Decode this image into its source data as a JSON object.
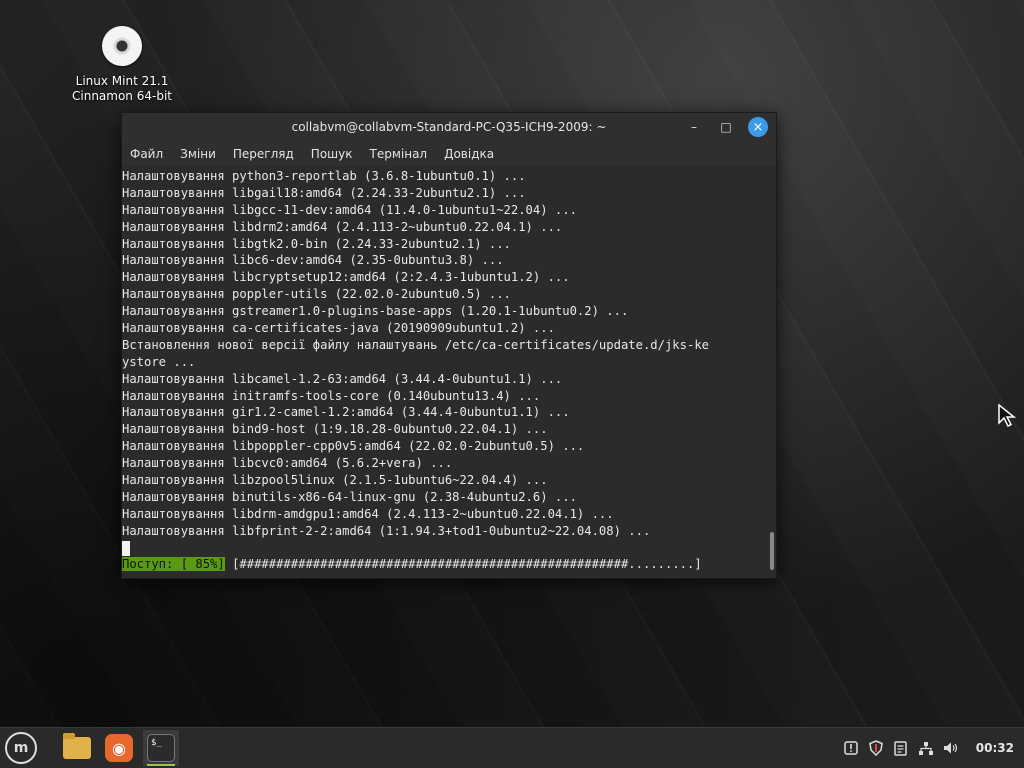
{
  "desktop": {
    "icon_label_line1": "Linux Mint 21.1",
    "icon_label_line2": "Cinnamon 64-bit"
  },
  "window": {
    "title": "collabvm@collabvm-Standard-PC-Q35-ICH9-2009: ~",
    "minimize_glyph": "–",
    "maximize_glyph": "□",
    "close_glyph": "×"
  },
  "menu": [
    "Файл",
    "Зміни",
    "Перегляд",
    "Пошук",
    "Термінал",
    "Довідка"
  ],
  "terminal_lines": [
    "Налаштовування python3-reportlab (3.6.8-1ubuntu0.1) ...",
    "Налаштовування libgail18:amd64 (2.24.33-2ubuntu2.1) ...",
    "Налаштовування libgcc-11-dev:amd64 (11.4.0-1ubuntu1~22.04) ...",
    "Налаштовування libdrm2:amd64 (2.4.113-2~ubuntu0.22.04.1) ...",
    "Налаштовування libgtk2.0-bin (2.24.33-2ubuntu2.1) ...",
    "Налаштовування libc6-dev:amd64 (2.35-0ubuntu3.8) ...",
    "Налаштовування libcryptsetup12:amd64 (2:2.4.3-1ubuntu1.2) ...",
    "Налаштовування poppler-utils (22.02.0-2ubuntu0.5) ...",
    "Налаштовування gstreamer1.0-plugins-base-apps (1.20.1-1ubuntu0.2) ...",
    "Налаштовування ca-certificates-java (20190909ubuntu1.2) ...",
    "Встановлення нової версії файлу налаштувань /etc/ca-certificates/update.d/jks-ke",
    "ystore ...",
    "Налаштовування libcamel-1.2-63:amd64 (3.44.4-0ubuntu1.1) ...",
    "Налаштовування initramfs-tools-core (0.140ubuntu13.4) ...",
    "Налаштовування gir1.2-camel-1.2:amd64 (3.44.4-0ubuntu1.1) ...",
    "Налаштовування bind9-host (1:9.18.28-0ubuntu0.22.04.1) ...",
    "Налаштовування libpoppler-cpp0v5:amd64 (22.02.0-2ubuntu0.5) ...",
    "Налаштовування libcvc0:amd64 (5.6.2+vera) ...",
    "Налаштовування libzpool5linux (2.1.5-1ubuntu6~22.04.4) ...",
    "Налаштовування binutils-x86-64-linux-gnu (2.38-4ubuntu2.6) ...",
    "Налаштовування libdrm-amdgpu1:amd64 (2.4.113-2~ubuntu0.22.04.1) ...",
    "Налаштовування libfprint-2-2:amd64 (1:1.94.3+tod1-0ubuntu2~22.04.08) ..."
  ],
  "progress": {
    "label": "Поступ: [ 85%]",
    "percent": 85,
    "bar": " [#####################################################.........]"
  },
  "taskbar": {
    "menu_glyph": "m",
    "pinned": [
      {
        "name": "files-icon",
        "active": false
      },
      {
        "name": "firefox-icon",
        "active": false
      },
      {
        "name": "terminal-icon",
        "active": true,
        "glyph": "$_"
      }
    ],
    "tray_icons": [
      "update-manager-icon",
      "shield-icon",
      "notes-icon",
      "network-icon",
      "volume-icon"
    ],
    "clock": "00:32"
  }
}
